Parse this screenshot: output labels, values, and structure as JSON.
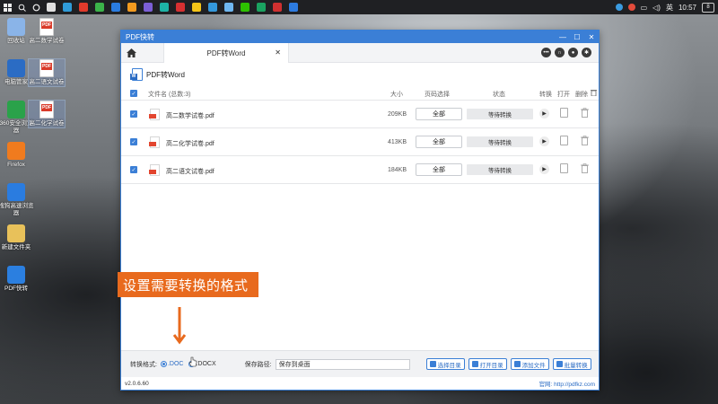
{
  "taskbar": {
    "start_icon": "windows-start-icon",
    "search_icon": "search-icon",
    "apps": [
      {
        "name": "task-view",
        "color": "#e0e0e0"
      },
      {
        "name": "edge",
        "color": "#2f9bd8"
      },
      {
        "name": "app-red",
        "color": "#e13a2b"
      },
      {
        "name": "app-green",
        "color": "#3bb34a"
      },
      {
        "name": "app-blue",
        "color": "#2a7ce0"
      },
      {
        "name": "app-orange",
        "color": "#f29a1f"
      },
      {
        "name": "app-purple",
        "color": "#7b5fd6"
      },
      {
        "name": "app-teal",
        "color": "#1db3a6"
      },
      {
        "name": "app-red2",
        "color": "#d63031"
      },
      {
        "name": "app-yellow",
        "color": "#f5c518"
      },
      {
        "name": "app-blue2",
        "color": "#3498db"
      },
      {
        "name": "app-lightblue",
        "color": "#6fb7f0"
      },
      {
        "name": "app-wechat",
        "color": "#2dc100"
      },
      {
        "name": "app-green2",
        "color": "#1aa260"
      },
      {
        "name": "app-red3",
        "color": "#cf3030"
      },
      {
        "name": "app-blue3",
        "color": "#2d7be0"
      }
    ],
    "ime": "英",
    "clock": "10:57",
    "notify": "8"
  },
  "desktop": {
    "icons": [
      {
        "label": "回收站",
        "icon": "recycle-bin-icon"
      },
      {
        "label": "高二数学试卷",
        "icon": "pdf-file-icon"
      },
      {
        "label": "电脑管家",
        "icon": "pc-manager-icon"
      },
      {
        "label": "高二语文试卷",
        "icon": "pdf-file-icon"
      },
      {
        "label": "360安全浏览器",
        "icon": "browser-360-icon"
      },
      {
        "label": "高二化学试卷",
        "icon": "pdf-file-icon"
      },
      {
        "label": "Firefox",
        "icon": "firefox-icon"
      },
      {
        "label": "搜狗高速浏览器",
        "icon": "sogou-browser-icon"
      },
      {
        "label": "新建文件夹",
        "icon": "folder-icon"
      },
      {
        "label": "PDF快转",
        "icon": "pdf-convert-icon"
      }
    ]
  },
  "window": {
    "title": "PDF快转",
    "tab_label": "PDF转Word",
    "tab_close": "✕",
    "doc_title": "PDF转Word",
    "columns": {
      "name": "文件名 (总数:3)",
      "size": "大小",
      "page": "页码选择",
      "status": "状态",
      "convert": "转换",
      "open": "打开",
      "delete": "删除"
    },
    "rows": [
      {
        "name": "高二数学试卷.pdf",
        "size": "209KB",
        "page": "全部",
        "status": "等待转换"
      },
      {
        "name": "高二化学试卷.pdf",
        "size": "413KB",
        "page": "全部",
        "status": "等待转换"
      },
      {
        "name": "高二语文试卷.pdf",
        "size": "184KB",
        "page": "全部",
        "status": "等待转换"
      }
    ],
    "bottom": {
      "format_label": "转换格式:",
      "format_doc": ".DOC",
      "format_docx": ".DOCX",
      "path_label": "保存路径:",
      "path_value": "保存到桌面",
      "btn_select_dir": "选择目录",
      "btn_open_dir": "打开目录",
      "btn_add_file": "添加文件",
      "btn_batch_convert": "批量转换"
    },
    "version": "v2.0.6.60",
    "website": "官网: http://pdfkz.com"
  },
  "annotation": {
    "text": "设置需要转换的格式",
    "color": "#e86a1e"
  }
}
